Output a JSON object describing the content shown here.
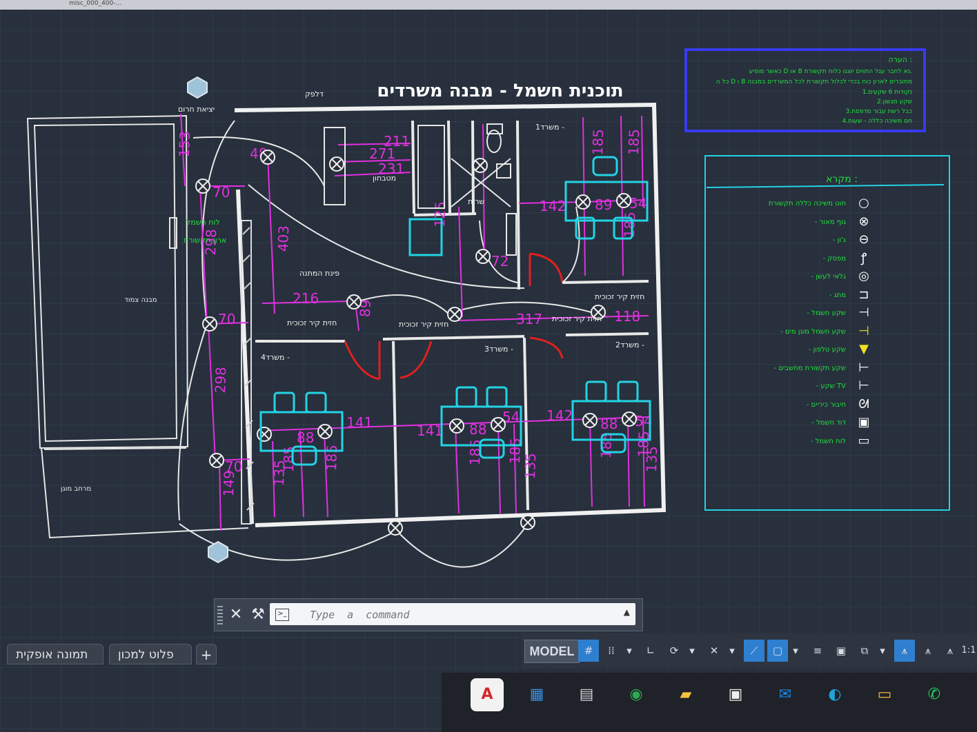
{
  "window": {
    "tab_label": "misc_000_400-..."
  },
  "drawing": {
    "title": "תוכנית חשמל - מבנה משרדים",
    "dims": {
      "d153": "153",
      "d70a": "70",
      "d298a": "298",
      "d70b": "70",
      "d298b": "298",
      "d70c": "70",
      "d149": "149",
      "d403": "403",
      "d48": "48",
      "d271": "271",
      "d211": "211",
      "d231": "231",
      "d216": "216",
      "d89": "89",
      "d142a": "142",
      "d89b": "89",
      "d54a": "54",
      "d185a": "185",
      "d185b": "185",
      "d125": "125",
      "d72": "72",
      "d317": "317",
      "d118": "118",
      "d141a": "141",
      "d141b": "141",
      "d88a": "88",
      "d88b": "88",
      "d88c": "88",
      "d54b": "54",
      "d142b": "142",
      "d54c": "54",
      "d135a": "135",
      "d185c": "185",
      "d185d": "185",
      "d185e": "185",
      "d185f": "185",
      "d185g": "185",
      "d135b": "135",
      "d135c": "135",
      "d185h": "185",
      "d185i": "185"
    },
    "rooms": {
      "kitchen": "מטבחון",
      "services": "שרות",
      "waiting": "פינת המתנה",
      "office1": "משרד1 -",
      "office2": "משרד2 -",
      "office3": "משרד3 -",
      "office4": "משרד4 -",
      "adjacent": "מבנה צמוד",
      "protected": "מרחב מוגן",
      "emergency_exit": "יציאת חרום",
      "elec_panel": "לוח חשמל",
      "comm_cabinet": "ארון תקשורת",
      "glass_wall": "חזית קיר זכוכית",
      "fixed_wall_a": "חזית קיר זכוכית",
      "fixed_wall_b": "חזית קיר זכוכית",
      "fixed_wall_c": "חזית קיר זכוכית",
      "door_label": "דלפק"
    }
  },
  "note_box": {
    "title": "הערה :",
    "lines": [
      "כאשר מופיע D או B נא לחבר עגל התווים יוצגו כלוח תקשורת.",
      "כל ה D ו B מחוברים לארון כוח בכדי לכלול תקשורת לכל המשרדים במבנה",
      "1.נקודות 6 שקעים",
      "2.שקע מגשון",
      "3.כבל רשת עבור מדפסת",
      "4.חם משיכה כללה - שעות"
    ]
  },
  "legend": {
    "title": "מקרא :",
    "items": [
      {
        "icon": "circle-symbol",
        "label": "חוט משיכה כללה תקשורת"
      },
      {
        "icon": "light-fixture-symbol",
        "label": "- גוף מאור"
      },
      {
        "icon": "fan-symbol",
        "label": "- ג'ון"
      },
      {
        "icon": "switch-symbol",
        "label": "- מפסק"
      },
      {
        "icon": "detector-symbol",
        "label": "- גלאי לעשן"
      },
      {
        "icon": "outlet-symbol",
        "label": "- מתג"
      },
      {
        "icon": "socket-symbol",
        "label": "- שקע חשמל"
      },
      {
        "icon": "protected-socket-symbol",
        "label": "- שקע חשמל מוגן מים"
      },
      {
        "icon": "phone-socket-symbol",
        "label": "- שקע טלפון"
      },
      {
        "icon": "data-socket-symbol",
        "label": "- שקע תקשורת מחשבים"
      },
      {
        "icon": "tv-socket-symbol",
        "label": "- שקע TV"
      },
      {
        "icon": "kitchen-outlet-symbol",
        "label": "- חיבור כיריים"
      },
      {
        "icon": "heater-symbol",
        "label": "- דוד חשמל"
      },
      {
        "icon": "panel-symbol",
        "label": "- לוח חשמל"
      }
    ]
  },
  "command_line": {
    "placeholder": "Type  a  command"
  },
  "layout_tabs": [
    "תמונה אופקית",
    "פלוט למכון"
  ],
  "status_bar": {
    "model": "MODEL",
    "scale": "1:1"
  },
  "taskbar": [
    {
      "icon": "autocad-icon",
      "text": "A",
      "color": "#d8262b"
    },
    {
      "icon": "calendar-icon",
      "text": "▦",
      "color": "#3d8fe0"
    },
    {
      "icon": "calculator-icon",
      "text": "▤",
      "color": "#cfd3d8"
    },
    {
      "icon": "chrome-icon",
      "text": "◉",
      "color": "#2fa84f"
    },
    {
      "icon": "file-explorer-icon",
      "text": "▰",
      "color": "#f3c33c"
    },
    {
      "icon": "store-icon",
      "text": "▣",
      "color": "#eeeeee"
    },
    {
      "icon": "mail-icon",
      "text": "✉",
      "color": "#1e88e5"
    },
    {
      "icon": "edge-icon",
      "text": "◐",
      "color": "#1fa3d8"
    },
    {
      "icon": "folder-icon",
      "text": "▭",
      "color": "#f2b632"
    },
    {
      "icon": "whatsapp-icon",
      "text": "✆",
      "color": "#25d366"
    }
  ]
}
